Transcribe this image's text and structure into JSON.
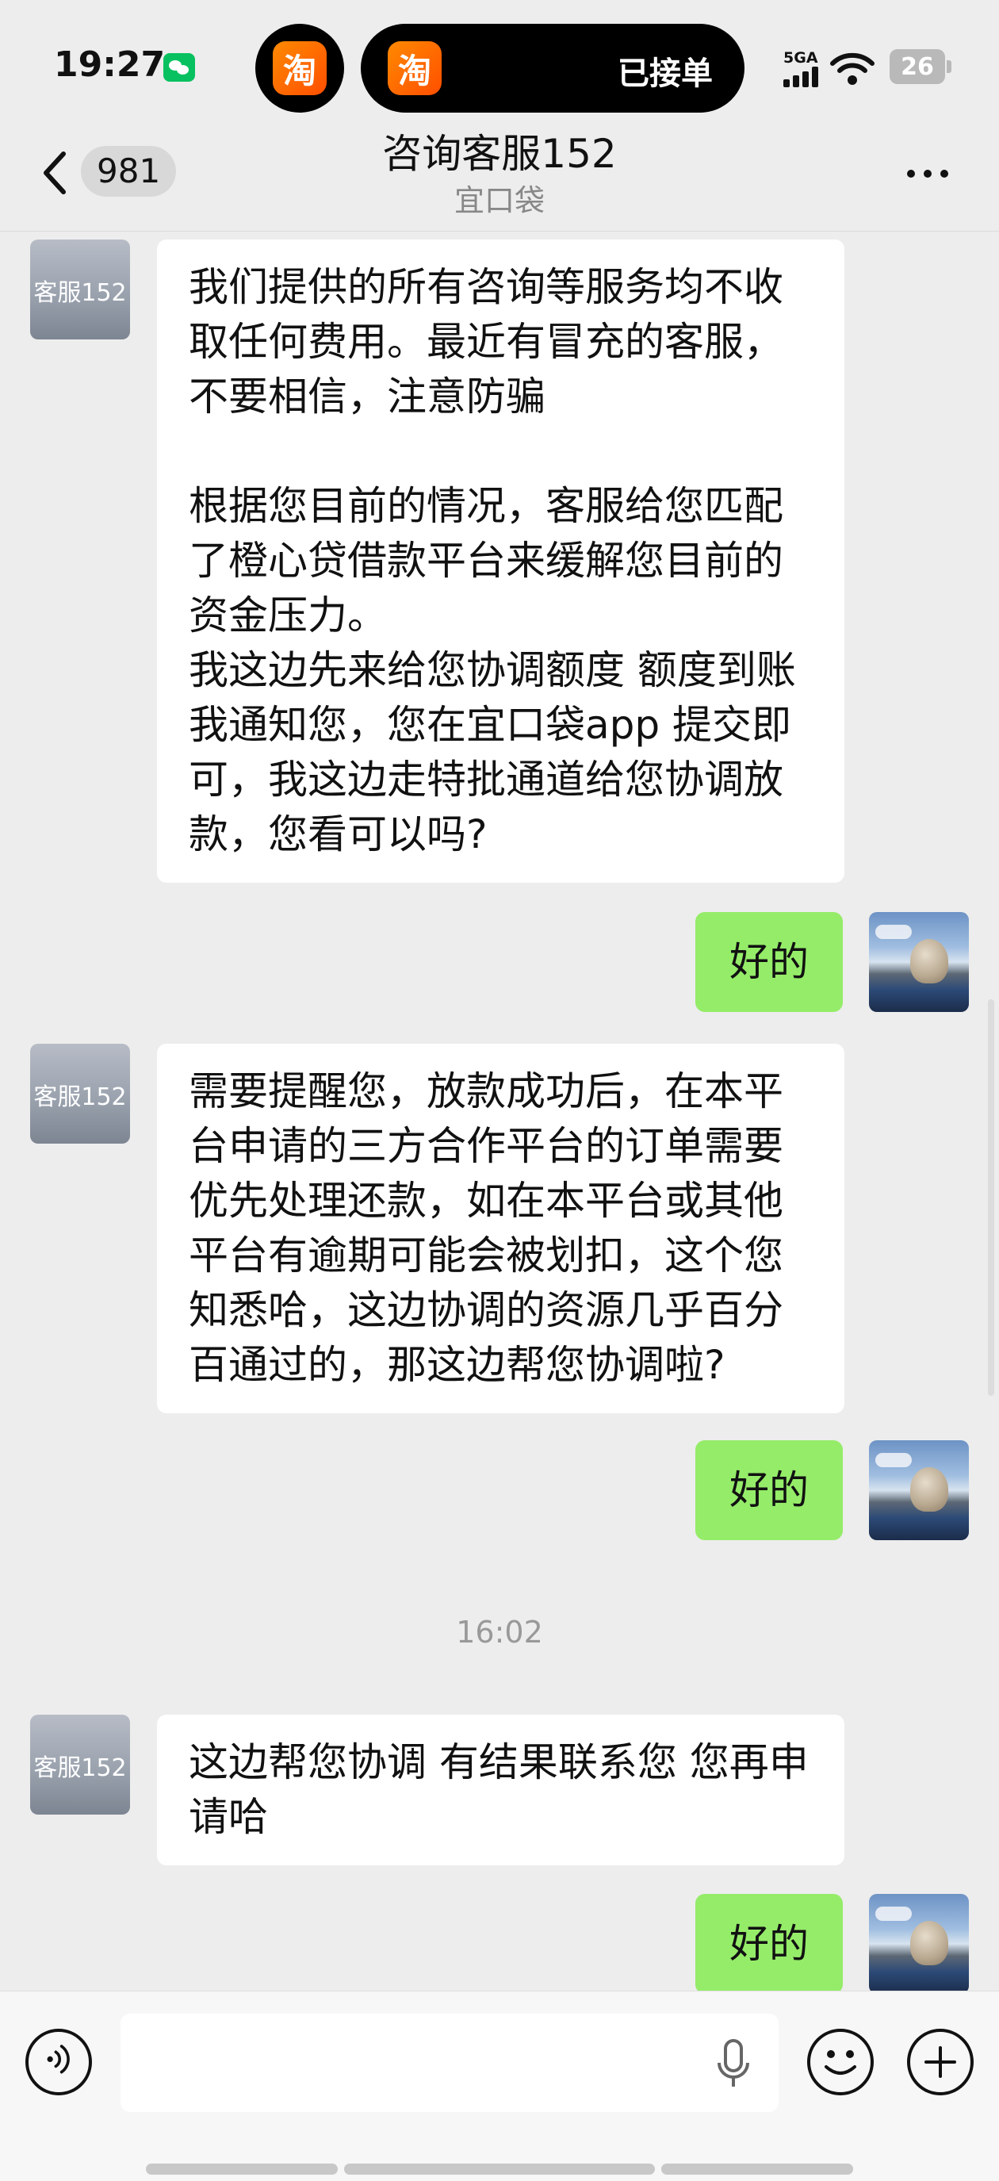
{
  "status_bar": {
    "time": "19:27",
    "notification_app_icon": "wechat-icon",
    "island_app_glyph": "淘",
    "island_status": "已接单",
    "network_label": "5GA",
    "battery_level": "26"
  },
  "nav": {
    "unread_count": "981",
    "title": "咨询客服152",
    "subtitle": "宜口袋"
  },
  "chat": {
    "agent_avatar_label": "客服152",
    "messages": [
      {
        "from": "agent",
        "text": "我们提供的所有咨询等服务均不收取任何费用。最近有冒充的客服，不要相信，注意防骗\n\n根据您目前的情况，客服给您匹配了橙心贷借款平台来缓解您目前的资金压力。\n我这边先来给您协调额度 额度到账我通知您，您在宜口袋app 提交即可，我这边走特批通道给您协调放款，您看可以吗?"
      },
      {
        "from": "user",
        "text": "好的"
      },
      {
        "from": "agent",
        "text": "需要提醒您，放款成功后，在本平台申请的三方合作平台的订单需要优先处理还款，如在本平台或其他平台有逾期可能会被划扣，这个您知悉哈，这边协调的资源几乎百分百通过的，那这边帮您协调啦?"
      },
      {
        "from": "user",
        "text": "好的"
      },
      {
        "from": "time",
        "text": "16:02"
      },
      {
        "from": "agent",
        "text": "这边帮您协调 有结果联系您 您再申请哈"
      },
      {
        "from": "user",
        "text": "好的"
      }
    ]
  },
  "input_bar": {
    "placeholder": "",
    "icons": [
      "voice-icon",
      "microphone-icon",
      "emoji-icon",
      "plus-icon"
    ]
  },
  "colors": {
    "background": "#ededed",
    "incoming_bubble": "#ffffff",
    "outgoing_bubble": "#95ec69",
    "island": "#000000",
    "taobao_orange": "#ff5a00",
    "wechat_green": "#07c160"
  }
}
